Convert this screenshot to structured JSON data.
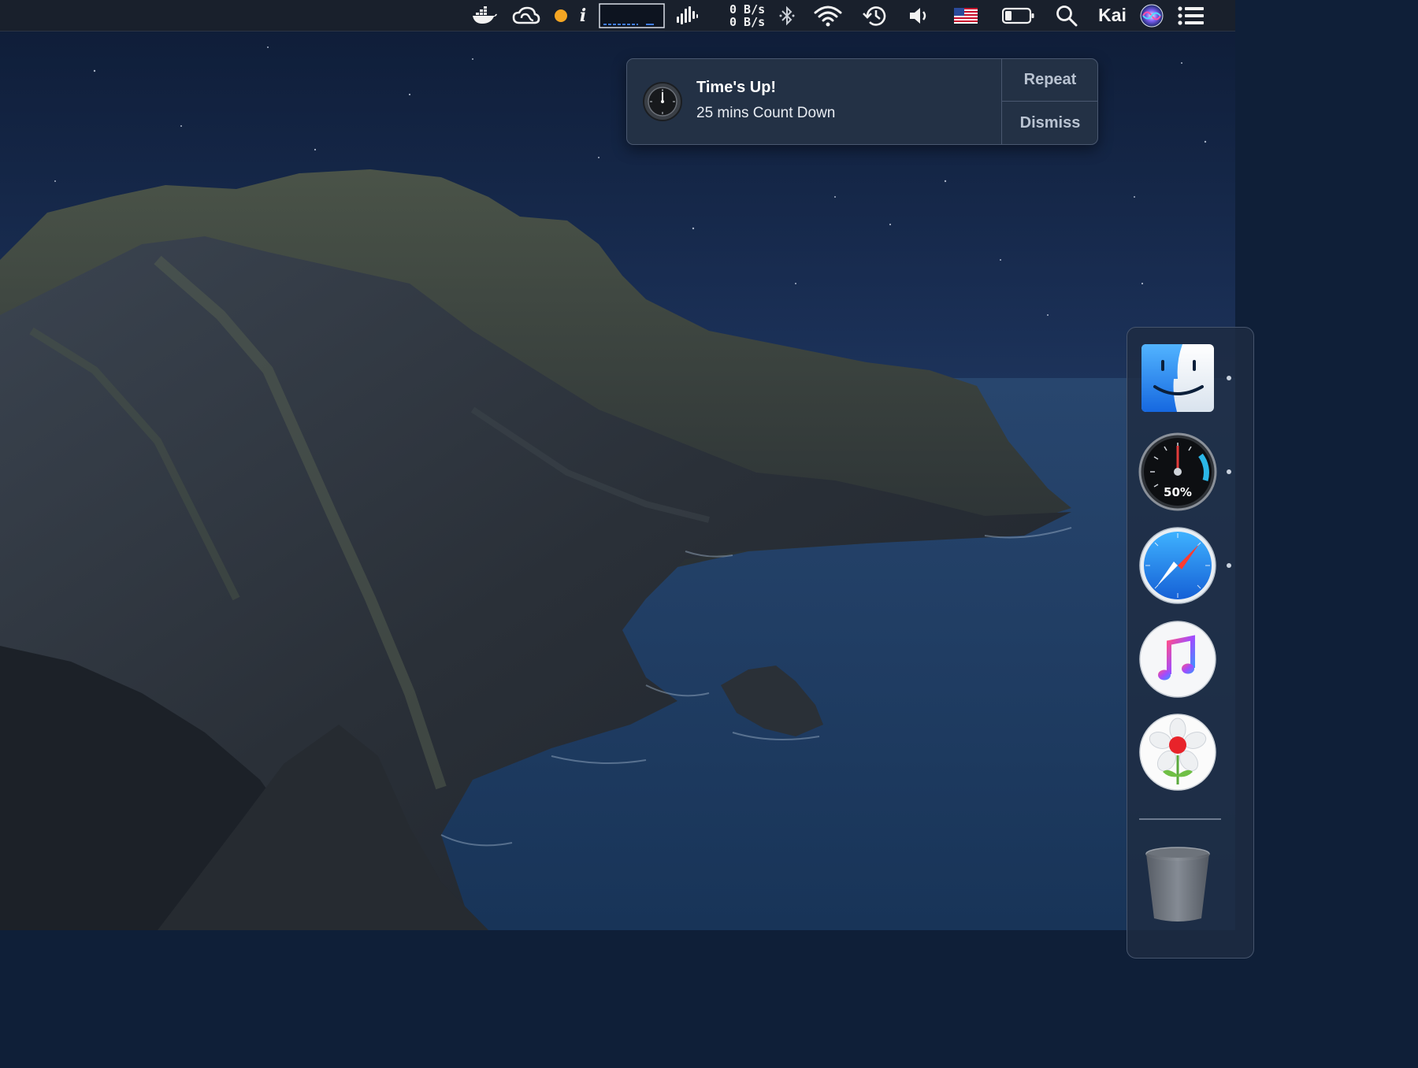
{
  "menubar": {
    "network_upload": "0 B/s",
    "network_download": "0 B/s",
    "info_glyph": "i",
    "user_name": "Kai",
    "icons": [
      "docker-icon",
      "creative-cloud-icon",
      "status-dot-icon",
      "info-icon",
      "graph-icon",
      "audio-meter-icon",
      "network-speed",
      "bluetooth-icon",
      "wifi-icon",
      "time-machine-icon",
      "volume-icon",
      "us-flag-icon",
      "battery-icon",
      "spotlight-search-icon",
      "siri-icon",
      "notification-center-icon"
    ]
  },
  "notification": {
    "icon": "timer-clock-icon",
    "title": "Time's Up!",
    "body": "25 mins Count Down",
    "actions": {
      "repeat": "Repeat",
      "dismiss": "Dismiss"
    }
  },
  "dock": {
    "apps": [
      {
        "name": "Finder",
        "icon": "finder-icon",
        "running": true
      },
      {
        "name": "Speedometer",
        "icon": "speedometer-icon",
        "gauge_label": "50%",
        "running": true
      },
      {
        "name": "Safari",
        "icon": "safari-icon",
        "running": true
      },
      {
        "name": "iTunes",
        "icon": "itunes-icon",
        "running": false
      },
      {
        "name": "Flower",
        "icon": "flower-app-icon",
        "running": false
      }
    ],
    "trash": {
      "icon": "trash-icon"
    }
  },
  "colors": {
    "menubar_bg": "#19202c",
    "notification_bg": "#243246",
    "sky": "#16284a",
    "sea": "#1e3e66",
    "accent_safari": "#1a7fe0",
    "finder_blue": "#2f8ff0"
  }
}
